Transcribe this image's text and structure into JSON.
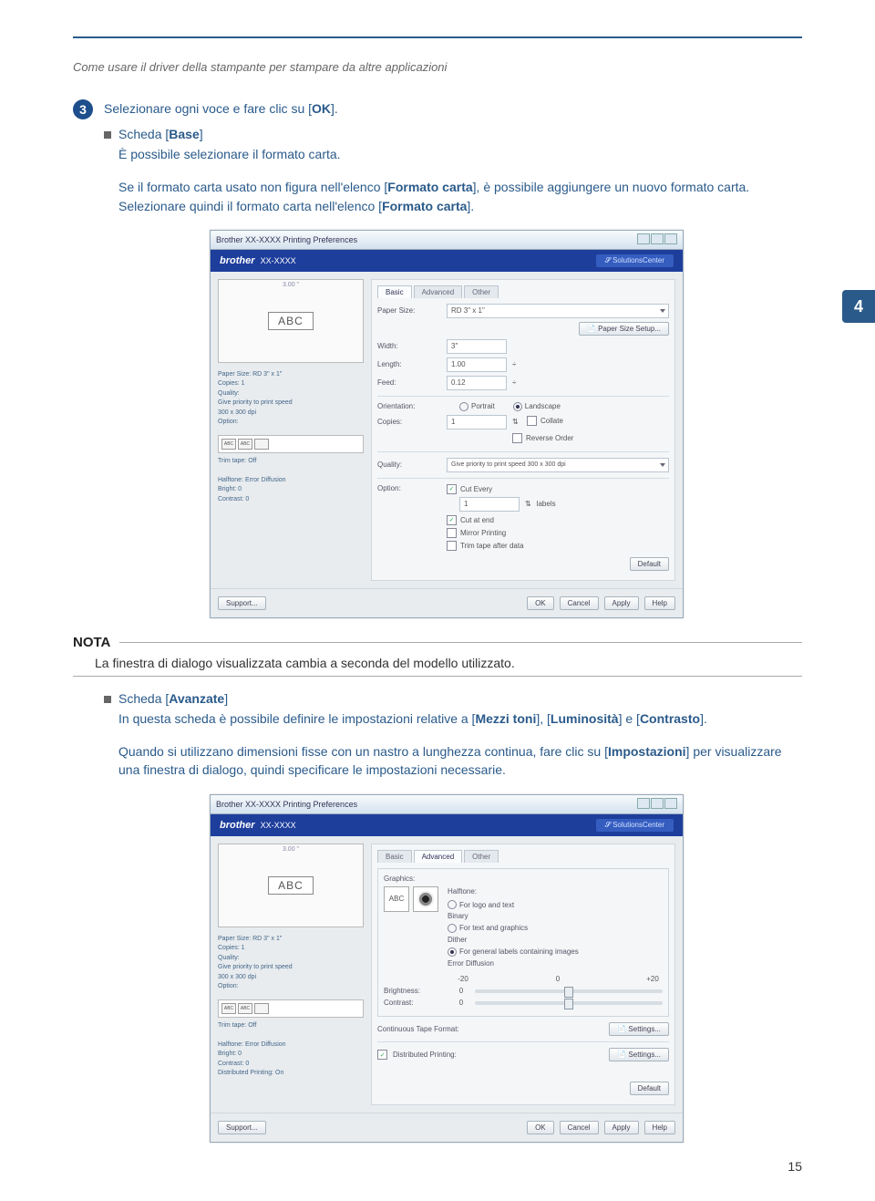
{
  "header": "Come usare il driver della stampante per stampare da altre applicazioni",
  "chapter_tab": "4",
  "step": {
    "num": "3",
    "text_a": "Selezionare ogni voce e fare clic su [",
    "text_ok": "OK",
    "text_b": "]."
  },
  "base": {
    "title_a": "Scheda [",
    "title_b": "Base",
    "title_c": "]",
    "line1": "È possibile selezionare il formato carta.",
    "line2_a": "Se il formato carta usato non figura nell'elenco [",
    "line2_b": "Formato carta",
    "line2_c": "], è possibile aggiungere un nuovo formato carta. Selezionare quindi il formato carta nell'elenco [",
    "line2_d": "Formato carta",
    "line2_e": "]."
  },
  "nota": {
    "title": "NOTA",
    "body": "La finestra di dialogo visualizzata cambia a seconda del modello utilizzato."
  },
  "adv": {
    "title_a": "Scheda [",
    "title_b": "Avanzate",
    "title_c": "]",
    "line1_a": "In questa scheda è possibile definire le impostazioni relative a [",
    "line1_b": "Mezzi toni",
    "line1_c": "], [",
    "line1_d": "Luminosità",
    "line1_e": "] e [",
    "line1_f": "Contrasto",
    "line1_g": "].",
    "line2_a": "Quando si utilizzano dimensioni fisse con un nastro a lunghezza continua, fare clic su [",
    "line2_b": "Impostazioni",
    "line2_c": "] per visualizzare una finestra di dialogo, quindi specificare le impostazioni necessarie."
  },
  "dialog": {
    "title": "Brother XX-XXXX Printing Preferences",
    "brand": "brother",
    "model": "XX-XXXX",
    "brand_right": "SolutionsCenter",
    "preview_abc": "ABC",
    "preview_size": "3.00 \"",
    "left_info": {
      "paper": "Paper Size: RD 3\" x 1\"",
      "copies": "Copies: 1",
      "quality": "Quality:",
      "quality2": "Give priority to print speed",
      "dpi": "300 x 300 dpi",
      "option": "Option:",
      "trim": "Trim tape: Off",
      "halftone": "Halftone: Error Diffusion",
      "bright": "Bright: 0",
      "contrast": "Contrast: 0",
      "dist": "Distributed Printing: On"
    },
    "tabs": {
      "basic": "Basic",
      "advanced": "Advanced",
      "other": "Other"
    },
    "basic_panel": {
      "paper_size": "Paper Size:",
      "paper_size_val": "RD 3\" x 1\"",
      "paper_setup": "Paper Size Setup...",
      "width": "Width:",
      "width_val": "3\"",
      "length": "Length:",
      "length_val": "1.00",
      "feed": "Feed:",
      "feed_val": "0.12",
      "orientation": "Orientation:",
      "portrait": "Portrait",
      "landscape": "Landscape",
      "copies": "Copies:",
      "copies_val": "1",
      "collate": "Collate",
      "reverse": "Reverse Order",
      "quality": "Quality:",
      "quality_val": "Give priority to print speed 300 x 300 dpi",
      "option": "Option:",
      "cut_every": "Cut Every",
      "labels": "labels",
      "cut_end": "Cut at end",
      "mirror": "Mirror Printing",
      "trim_after": "Trim tape after data",
      "default": "Default"
    },
    "adv_panel": {
      "graphics": "Graphics:",
      "halftone": "Halftone:",
      "ht1": "For logo and text\nBinary",
      "ht2": "For text and graphics\nDither",
      "ht3": "For general labels containing images\nError Diffusion",
      "brightness": "Brightness:",
      "contrast": "Contrast:",
      "minus20": "-20",
      "zero": "0",
      "plus20": "+20",
      "cont_format": "Continuous Tape Format:",
      "dist_print": "Distributed Printing:",
      "settings": "Settings...",
      "default": "Default"
    },
    "footer": {
      "support": "Support...",
      "ok": "OK",
      "cancel": "Cancel",
      "apply": "Apply",
      "help": "Help"
    }
  },
  "page_num": "15"
}
